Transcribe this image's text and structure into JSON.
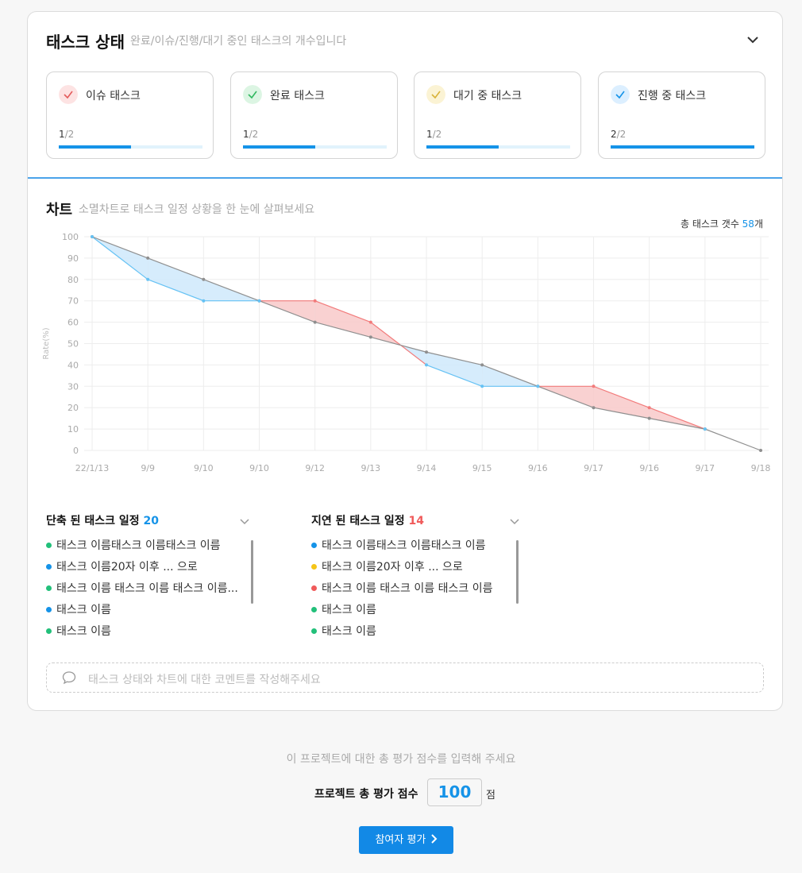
{
  "status": {
    "title": "태스크 상태",
    "subtitle": "완료/이슈/진행/대기 중인 태스크의 개수입니다",
    "tiles": [
      {
        "label": "이슈 태스크",
        "count": "1",
        "total": "/2",
        "fraction": 0.5,
        "icon": "check-icon",
        "icon_bg": "#fde3e3",
        "icon_color": "#e45c5c"
      },
      {
        "label": "완료 태스크",
        "count": "1",
        "total": "/2",
        "fraction": 0.5,
        "icon": "check-icon",
        "icon_bg": "#dcf5e3",
        "icon_color": "#32b860"
      },
      {
        "label": "대기 중 태스크",
        "count": "1",
        "total": "/2",
        "fraction": 0.5,
        "icon": "check-icon",
        "icon_bg": "#fbf3d4",
        "icon_color": "#d9b33a"
      },
      {
        "label": "진행 중 태스크",
        "count": "2",
        "total": "/2",
        "fraction": 1.0,
        "icon": "check-icon",
        "icon_bg": "#dcefff",
        "icon_color": "#1593e8"
      }
    ]
  },
  "chart": {
    "title": "차트",
    "subtitle": "소멸차트로 태스크 일정 상황을 한 눈에 살펴보세요",
    "total_prefix": "총 태스크 갯수 ",
    "total_num": "58",
    "total_suffix": "개"
  },
  "chart_data": {
    "type": "line",
    "ylabel": "Rate(%)",
    "ylim": [
      0,
      100
    ],
    "yticks": [
      0,
      10,
      20,
      30,
      40,
      50,
      60,
      70,
      80,
      90,
      100
    ],
    "categories": [
      "22/1/13",
      "9/9",
      "9/10",
      "9/10",
      "9/12",
      "9/13",
      "9/14",
      "9/15",
      "9/16",
      "9/17",
      "9/16",
      "9/17",
      "9/18"
    ],
    "series": [
      {
        "values": [
          100,
          90,
          80,
          70,
          60,
          53,
          46,
          40,
          30,
          20,
          15,
          10,
          0
        ],
        "color": "#8f8f8f"
      },
      {
        "values": [
          100,
          80,
          70,
          70,
          70,
          60,
          40,
          30,
          30,
          30,
          20,
          10,
          null
        ],
        "color": "#66c2f4"
      }
    ],
    "ahead_fill": "#cfe9fb",
    "behind_fill": "#f8c9c9",
    "grid": true
  },
  "shortened": {
    "title": "단축 된 태스크 일정",
    "count": "20",
    "count_color": "#1593e8",
    "items": [
      {
        "label": "태스크 이름태스크 이름태스크 이름",
        "color": "#22c07a"
      },
      {
        "label": "태스크 이름20자 이후 ... 으로",
        "color": "#1593e8"
      },
      {
        "label": "태스크 이름 태스크 이름 태스크 이름...",
        "color": "#22c07a"
      },
      {
        "label": "태스크 이름",
        "color": "#1593e8"
      },
      {
        "label": "태스크 이름",
        "color": "#22c07a"
      }
    ]
  },
  "delayed": {
    "title": "지연 된 태스크 일정",
    "count": "14",
    "count_color": "#f05a5a",
    "items": [
      {
        "label": "태스크 이름태스크 이름태스크 이름",
        "color": "#1593e8"
      },
      {
        "label": "태스크 이름20자 이후 ... 으로",
        "color": "#f5c518"
      },
      {
        "label": "태스크 이름 태스크 이름 태스크 이름",
        "color": "#f05a5a"
      },
      {
        "label": "태스크 이름",
        "color": "#22c07a"
      },
      {
        "label": "태스크 이름",
        "color": "#22c07a"
      }
    ]
  },
  "comment": {
    "placeholder": "태스크 상태와 차트에 대한 코멘트를 작성해주세요"
  },
  "evaluation": {
    "hint": "이 프로젝트에 대한 총 평가 점수를 입력해 주세요",
    "label": "프로젝트 총 평가 점수",
    "value": "100",
    "unit": "점",
    "button": "참여자 평가"
  }
}
